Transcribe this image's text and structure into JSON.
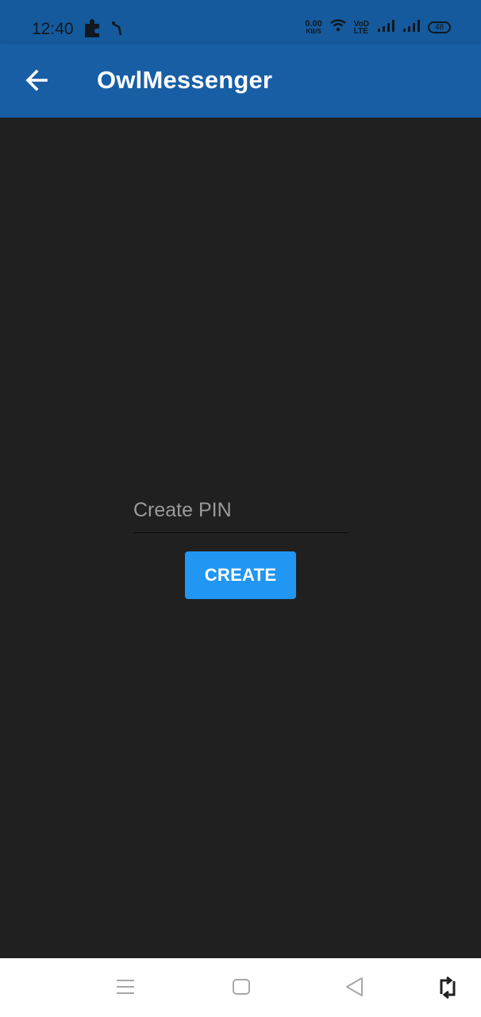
{
  "status_bar": {
    "time": "12:40",
    "net_speed_value": "0.00",
    "net_speed_unit": "KB/S",
    "volte_label_top": "VoD",
    "volte_label_bottom": "LTE",
    "battery_level": "48",
    "icons": [
      "puzzle-icon",
      "notification-icon",
      "wifi-icon",
      "signal-icon",
      "signal-icon",
      "battery-icon"
    ]
  },
  "app_bar": {
    "title": "OwlMessenger",
    "back_icon": "arrow-left-icon"
  },
  "form": {
    "pin_placeholder": "Create PIN",
    "pin_value": "",
    "create_label": "CREATE"
  },
  "nav_bar": {
    "icons": [
      "menu-icon",
      "home-icon",
      "back-icon",
      "rotate-icon"
    ]
  },
  "colors": {
    "status_bar": "#155A9C",
    "app_bar": "#175EA5",
    "background": "#202020",
    "button": "#2196F3",
    "nav_bar": "#FFFFFF"
  }
}
